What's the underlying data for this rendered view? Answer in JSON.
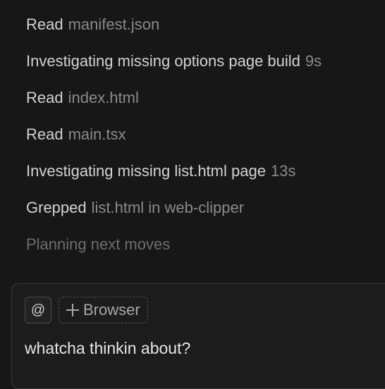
{
  "activity": [
    {
      "verb": "Read",
      "detail": "manifest.json",
      "duration": ""
    },
    {
      "verb": "Investigating missing options page build",
      "detail": "9s",
      "duration": ""
    },
    {
      "verb": "Read",
      "detail": "index.html",
      "duration": ""
    },
    {
      "verb": "Read",
      "detail": "main.tsx",
      "duration": ""
    },
    {
      "verb": "Investigating missing list.html page",
      "detail": "13s",
      "duration": ""
    },
    {
      "verb": "Grepped",
      "detail": "list.html in web-clipper",
      "duration": ""
    },
    {
      "verb": "Planning next moves",
      "detail": "",
      "duration": ""
    }
  ],
  "composer": {
    "mention_label": "@",
    "context_label": "Browser",
    "input_text": "whatcha thinkin about?"
  },
  "icons": {
    "mention": "at-icon",
    "add_context": "plus-icon"
  },
  "colors": {
    "background": "#171717",
    "text_primary": "#d2d2d2",
    "text_secondary": "#8a8a8a",
    "text_faded": "#6e6e6e"
  }
}
